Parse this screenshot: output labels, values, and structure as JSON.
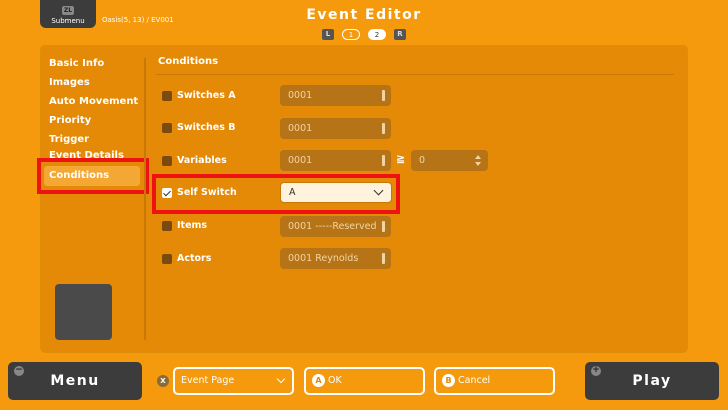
{
  "header": {
    "submenu_badge": "ZL",
    "submenu_label": "Submenu",
    "breadcrumb": "Oasis(5, 13) / EV001",
    "title": "Event Editor",
    "pager": {
      "left_key": "L",
      "pages": [
        "1",
        "2"
      ],
      "active_page": "2",
      "right_key": "R"
    }
  },
  "sidebar": {
    "items": [
      "Basic Info",
      "Images",
      "Auto Movement",
      "Priority",
      "Trigger",
      "Event Details",
      "Conditions"
    ],
    "active": "Conditions"
  },
  "conditions": {
    "title": "Conditions",
    "rows": [
      {
        "label": "Switches A",
        "checked": false,
        "value": "0001"
      },
      {
        "label": "Switches B",
        "checked": false,
        "value": "0001"
      },
      {
        "label": "Variables",
        "checked": false,
        "value": "0001",
        "operator": "≧",
        "compare_value": "0"
      },
      {
        "label": "Self Switch",
        "checked": true,
        "value": "A"
      },
      {
        "label": "Items",
        "checked": false,
        "value": "0001 -----Reserved"
      },
      {
        "label": "Actors",
        "checked": false,
        "value": "0001 Reynolds"
      }
    ]
  },
  "footer": {
    "menu_label": "Menu",
    "menu_key": "−",
    "event_page_key": "X",
    "event_page_label": "Event Page",
    "ok_key": "A",
    "ok_label": "OK",
    "cancel_key": "B",
    "cancel_label": "Cancel",
    "play_label": "Play",
    "play_key": "+"
  },
  "colors": {
    "background": "#F49A0C",
    "panel": "#E48A06",
    "highlight": "#EE1212",
    "field": "#B77416",
    "dark_button": "#3C3C3C"
  }
}
